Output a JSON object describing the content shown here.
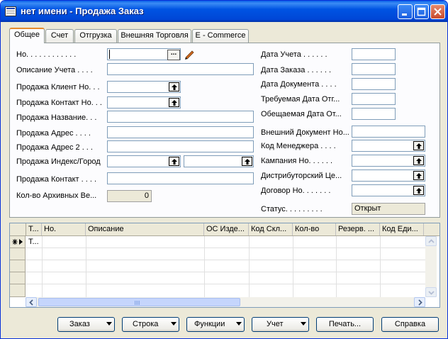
{
  "window": {
    "title": "нет имени - Продажа Заказ"
  },
  "tabs": [
    {
      "label": "Общее",
      "active": true
    },
    {
      "label": "Счет"
    },
    {
      "label": "Отгрузка"
    },
    {
      "label": "Внешняя Торговля"
    },
    {
      "label": "E - Commerce"
    }
  ],
  "general": {
    "left": {
      "no": {
        "label": "Но. . . . . . . . . . . .",
        "value": ""
      },
      "posting_description": {
        "label": "Описание Учета . . . .",
        "value": ""
      },
      "sell_to_customer_no": {
        "label": "Продажа Клиент Но. . .",
        "value": ""
      },
      "sell_to_contact_no": {
        "label": "Продажа Контакт Но. . .",
        "value": ""
      },
      "sell_to_name": {
        "label": "Продажа Название. . .",
        "value": ""
      },
      "sell_to_address": {
        "label": "Продажа Адрес  . . . .",
        "value": ""
      },
      "sell_to_address2": {
        "label": "Продажа Адрес 2  . . .",
        "value": ""
      },
      "post_code_city": {
        "label": "Продажа Индекс/Город",
        "value_postcode": "",
        "value_city": ""
      },
      "sell_to_contact": {
        "label": "Продажа Контакт . . . .",
        "value": ""
      },
      "archived_versions": {
        "label": "Кол-во Архивных Ве...",
        "value": "0"
      }
    },
    "right": {
      "posting_date": {
        "label": "Дата Учета  . . . . . .",
        "value": ""
      },
      "order_date": {
        "label": "Дата Заказа . . . . . .",
        "value": ""
      },
      "document_date": {
        "label": "Дата Документа . . . .",
        "value": ""
      },
      "requested_delivery": {
        "label": "Требуемая Дата Отг...",
        "value": ""
      },
      "promised_delivery": {
        "label": "Обещаемая Дата От...",
        "value": ""
      },
      "external_doc_no": {
        "label": "Внешний Документ Но...",
        "value": ""
      },
      "salesperson_code": {
        "label": "Код Менеджера  . . . .",
        "value": ""
      },
      "campaign_no": {
        "label": "Кампания Но.  . . . . .",
        "value": ""
      },
      "responsibility_center": {
        "label": "Дистрибуторский Це...",
        "value": ""
      },
      "contract_no": {
        "label": "Договор Но. . . . . . .",
        "value": ""
      },
      "status": {
        "label": "Статус. . . . . . . . .",
        "value": "Открыт"
      }
    }
  },
  "lines": {
    "columns": [
      "Т...",
      "Но.",
      "Описание",
      "ОС Изде...",
      "Код Скл...",
      "Кол-во",
      "Резерв. ...",
      "Код Еди..."
    ],
    "rows": [
      {
        "type": "Т..."
      }
    ]
  },
  "buttons": {
    "order": "Заказ",
    "line": "Строка",
    "functions": "Функции",
    "posting": "Учет",
    "print": "Печать...",
    "help": "Справка"
  },
  "colors": {
    "titlebar": "#0054e3",
    "face": "#ece9d8",
    "tab_accent": "#e68b2c",
    "field_border": "#7f9db9"
  }
}
